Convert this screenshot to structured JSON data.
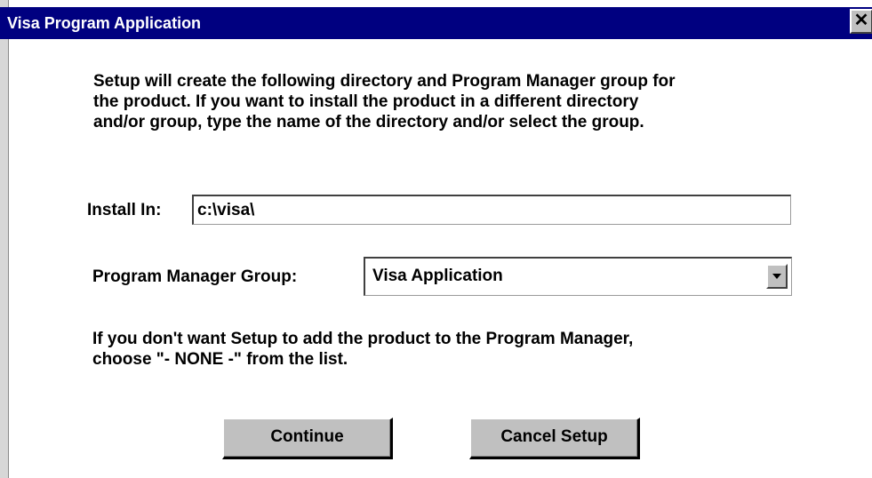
{
  "window": {
    "title": "Visa Program Application",
    "close_glyph": "✕"
  },
  "intro": {
    "line1": "Setup will create the following directory and Program Manager group for",
    "line2": "the product.  If you want to install the product in a different directory",
    "line3": "and/or group, type the name of the directory and/or select the group."
  },
  "install": {
    "label": "Install In:",
    "value": "c:\\visa\\"
  },
  "group": {
    "label": "Program Manager Group:",
    "selected": "Visa Application"
  },
  "note": {
    "line1": "If you don't want Setup to add the product to the Program Manager,",
    "line2": "choose \"- NONE -\" from the list."
  },
  "buttons": {
    "continue": "Continue",
    "cancel": "Cancel Setup"
  },
  "colors": {
    "titlebar": "#000080",
    "face": "#c0c0c0",
    "background": "#ffffff"
  },
  "icons": {
    "close": "close-icon",
    "dropdown": "chevron-down-icon"
  }
}
